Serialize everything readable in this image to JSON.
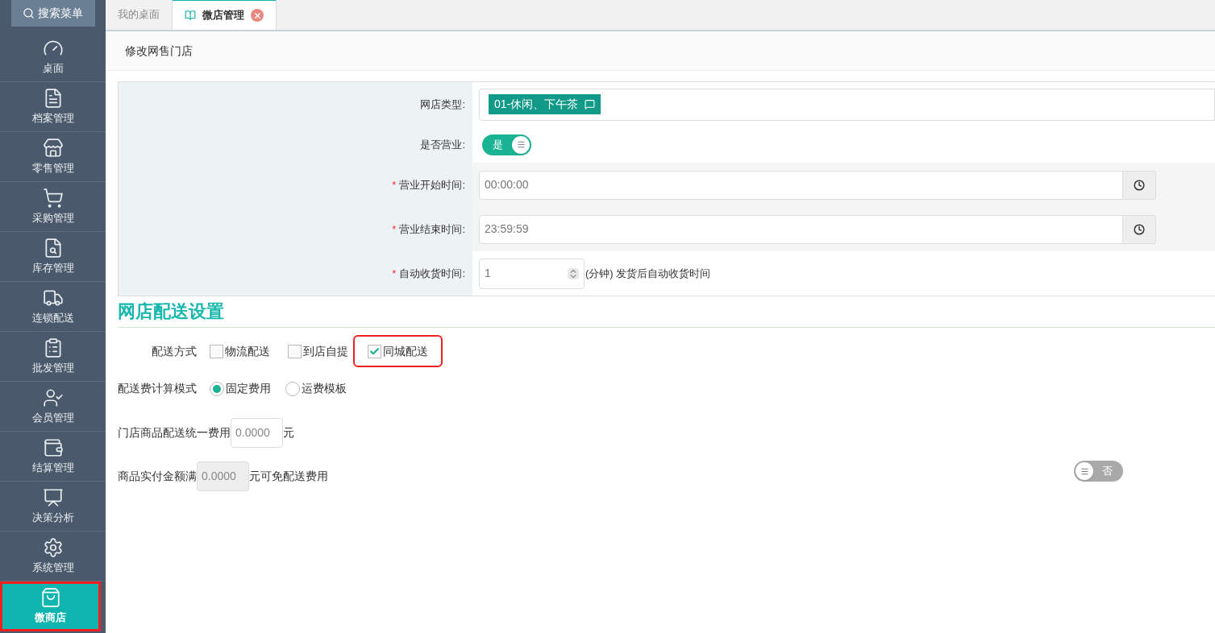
{
  "sidebar": {
    "search_button": "搜索菜单",
    "items": [
      {
        "label": "桌面",
        "selected": false,
        "highlighted": false
      },
      {
        "label": "档案管理",
        "selected": false,
        "highlighted": false
      },
      {
        "label": "零售管理",
        "selected": false,
        "highlighted": false
      },
      {
        "label": "采购管理",
        "selected": false,
        "highlighted": false
      },
      {
        "label": "库存管理",
        "selected": false,
        "highlighted": false
      },
      {
        "label": "连锁配送",
        "selected": false,
        "highlighted": false
      },
      {
        "label": "批发管理",
        "selected": false,
        "highlighted": false
      },
      {
        "label": "会员管理",
        "selected": false,
        "highlighted": false
      },
      {
        "label": "结算管理",
        "selected": false,
        "highlighted": false
      },
      {
        "label": "决策分析",
        "selected": false,
        "highlighted": false
      },
      {
        "label": "系统管理",
        "selected": false,
        "highlighted": false
      },
      {
        "label": "微商店",
        "selected": true,
        "highlighted": true
      }
    ]
  },
  "tabs": [
    {
      "label": "我的桌面",
      "selected": false,
      "closable": false
    },
    {
      "label": "微店管理",
      "selected": true,
      "closable": true
    }
  ],
  "page_title": "修改网售门店",
  "form": {
    "shop_type": {
      "label": "网店类型:",
      "tag": "01-休闲、下午茶"
    },
    "open": {
      "label": "是否营业:",
      "on": true,
      "text": "是"
    },
    "start_time": {
      "label": "营业开始时间:",
      "required": "*",
      "value": "00:00:00"
    },
    "end_time": {
      "label": "营业结束时间:",
      "required": "*",
      "value": "23:59:59"
    },
    "auto_receive": {
      "label": "自动收货时间:",
      "required": "*",
      "value": "1",
      "hint": "(分钟) 发货后自动收货时间"
    }
  },
  "delivery": {
    "title": "网店配送设置",
    "method_label": "配送方式",
    "methods": [
      {
        "label": "物流配送",
        "checked": false,
        "highlighted": false
      },
      {
        "label": "到店自提",
        "checked": false,
        "highlighted": false
      },
      {
        "label": "同城配送",
        "checked": true,
        "highlighted": true
      }
    ],
    "fee_mode_label": "配送费计算模式",
    "fee_modes": [
      {
        "label": "固定费用",
        "selected": true
      },
      {
        "label": "运费模板",
        "selected": false
      }
    ],
    "unified_fee": {
      "label": "门店商品配送统一费用",
      "placeholder": "0.0000",
      "unit": "元"
    },
    "free_threshold": {
      "label": "商品实付金额满",
      "placeholder": "0.0000",
      "disabled": true,
      "suffix": "元可免配送费用",
      "on": false,
      "toggle_text": "否"
    }
  }
}
